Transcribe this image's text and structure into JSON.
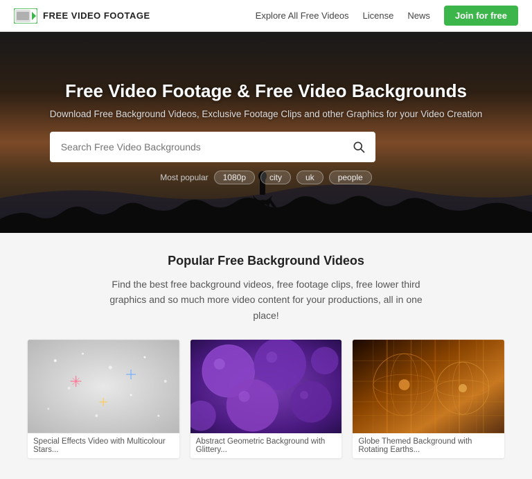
{
  "header": {
    "logo_text": "FREE VIDEO FOOTAGE",
    "nav": {
      "explore": "Explore All Free Videos",
      "license": "License",
      "news": "News",
      "join": "Join for free"
    }
  },
  "hero": {
    "title": "Free Video Footage & Free Video Backgrounds",
    "subtitle": "Download Free Background Videos, Exclusive Footage Clips and other Graphics for your Video Creation",
    "search_placeholder": "Search Free Video Backgrounds",
    "tags_label": "Most popular",
    "tags": [
      "1080p",
      "city",
      "uk",
      "people"
    ]
  },
  "main": {
    "section_title": "Popular Free Background Videos",
    "section_desc": "Find the best free background videos, free footage clips, free lower third graphics and so much more video content for your productions, all in one place!",
    "videos": [
      {
        "caption": "Special Effects Video with Multicolour Stars..."
      },
      {
        "caption": "Abstract Geometric Background with Glittery..."
      },
      {
        "caption": "Globe Themed Background with Rotating Earths..."
      }
    ]
  }
}
